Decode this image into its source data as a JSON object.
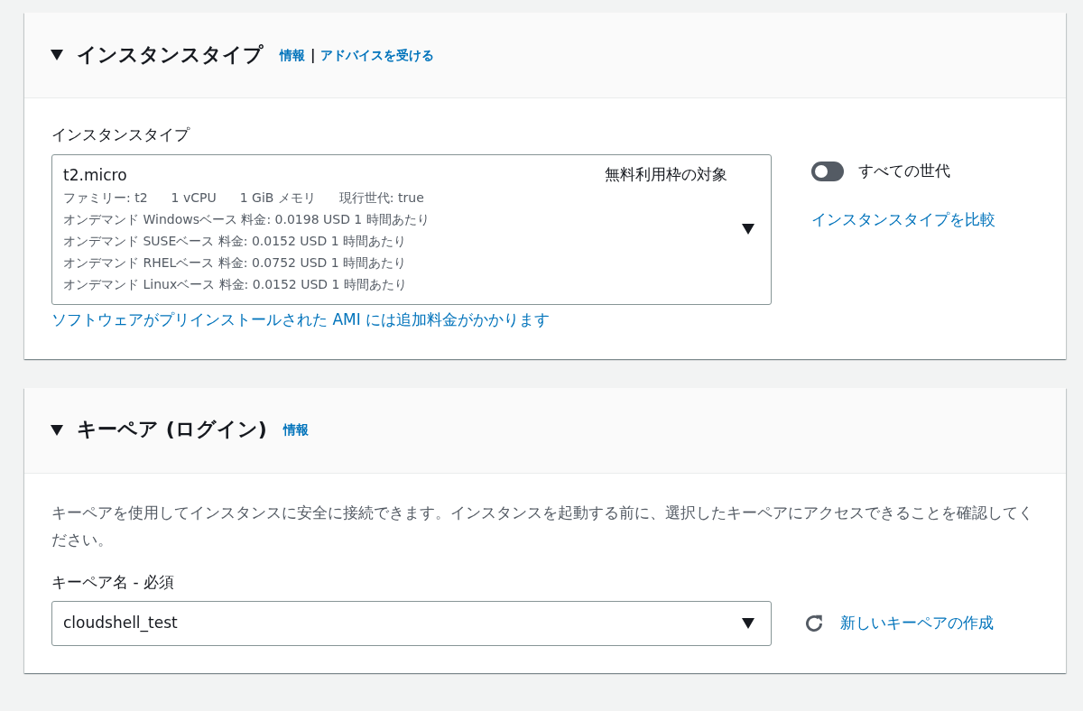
{
  "sections": [
    {
      "title": "インスタンスタイプ",
      "expanded": true,
      "header_links": [
        "情報",
        "アドバイスを受ける"
      ],
      "link_separator": "|",
      "kind": "instance",
      "field_label": "インスタンスタイプ",
      "select": {
        "value": "t2.micro",
        "badge": "無料利用枠の対象",
        "specs": [
          "ファミリー: t2",
          "1 vCPU",
          "1 GiB メモリ",
          "現行世代: true"
        ],
        "prices": [
          "オンデマンド Windowsベース 料金: 0.0198 USD 1 時間あたり",
          "オンデマンド SUSEベース 料金: 0.0152 USD 1 時間あたり",
          "オンデマンド RHELベース 料金: 0.0752 USD 1 時間あたり",
          "オンデマンド Linuxベース 料金: 0.0152 USD 1 時間あたり"
        ]
      },
      "note_link": "ソフトウェアがプリインストールされた AMI には追加料金がかかります",
      "toggle": {
        "label": "すべての世代",
        "on": false
      },
      "side_link": "インスタンスタイプを比較"
    },
    {
      "title": "キーペア (ログイン)",
      "expanded": true,
      "header_links": [
        "情報"
      ],
      "kind": "keypair",
      "description": "キーペアを使用してインスタンスに安全に接続できます。インスタンスを起動する前に、選択したキーペアにアクセスできることを確認してください。",
      "field_label": "キーペア名 - 必須",
      "select": {
        "value": "cloudshell_test"
      },
      "side_link": "新しいキーペアの作成"
    }
  ]
}
